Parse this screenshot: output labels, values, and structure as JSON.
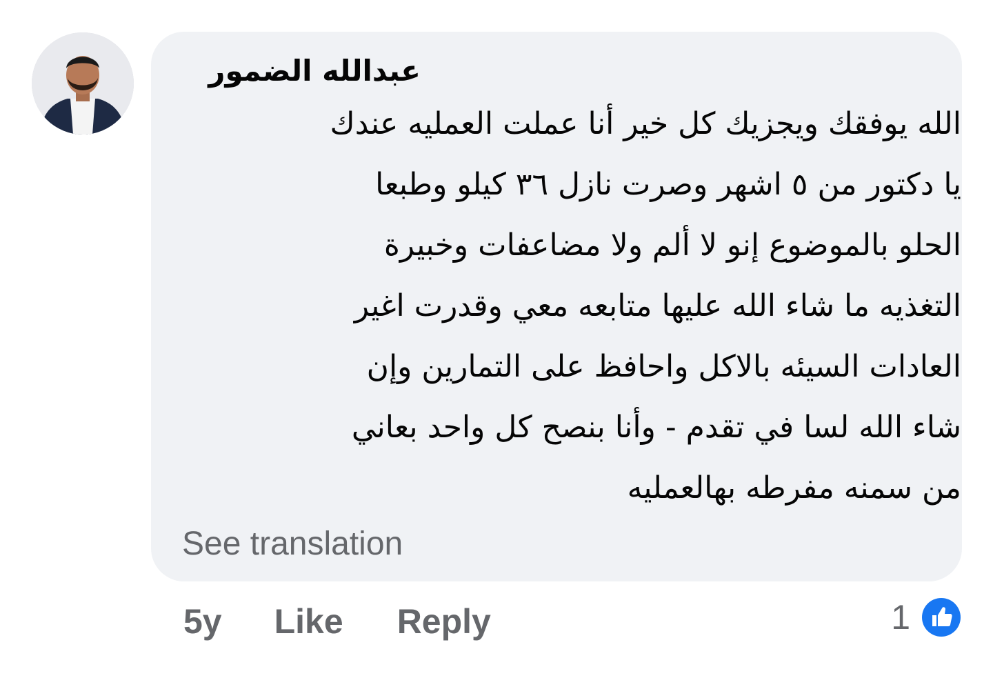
{
  "comment": {
    "author": "عبدالله الضمور",
    "avatar_icon": "profile-photo",
    "lines": [
      "الله يوفقك ويجزيك كل خير أنا عملت العمليه عندك",
      "يا دكتور من ٥ اشهر وصرت نازل ٣٦ كيلو وطبعا",
      "الحلو بالموضوع إنو لا ألم ولا مضاعفات وخبيرة",
      "التغذيه ما شاء الله عليها متابعه معي وقدرت اغير",
      "العادات السيئه بالاكل واحافظ على التمارين وإن",
      "شاء الله لسا في تقدم - وأنا بنصح كل واحد بعاني",
      "من سمنه مفرطه بهالعمليه"
    ],
    "see_translation": "See translation",
    "bubble_color": "#f0f2f5"
  },
  "actions": {
    "time": "5y",
    "like": "Like",
    "reply": "Reply"
  },
  "reactions": {
    "count": "1",
    "icon": "like-icon",
    "color": "#1877f2"
  }
}
